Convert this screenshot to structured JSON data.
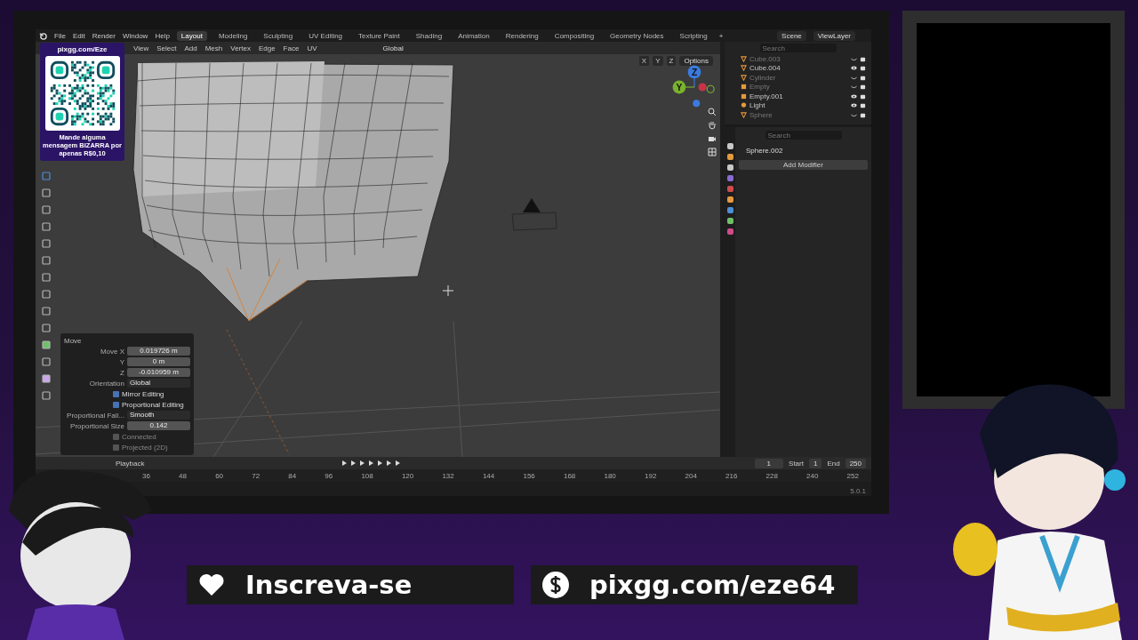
{
  "blender": {
    "menu": [
      "File",
      "Edit",
      "Render",
      "Window",
      "Help"
    ],
    "workspaces": [
      {
        "label": "Layout",
        "selected": true
      },
      {
        "label": "Modeling",
        "selected": false
      },
      {
        "label": "Sculpting",
        "selected": false
      },
      {
        "label": "UV Editing",
        "selected": false
      },
      {
        "label": "Texture Paint",
        "selected": false
      },
      {
        "label": "Shading",
        "selected": false
      },
      {
        "label": "Animation",
        "selected": false
      },
      {
        "label": "Rendering",
        "selected": false
      },
      {
        "label": "Compositing",
        "selected": false
      },
      {
        "label": "Geometry Nodes",
        "selected": false
      },
      {
        "label": "Scripting",
        "selected": false
      }
    ],
    "add_workspace": "+",
    "scene": "Scene",
    "view_layer": "ViewLayer",
    "viewport": {
      "menus": [
        "View",
        "Select",
        "Add",
        "Mesh",
        "Vertex",
        "Edge",
        "Face",
        "UV"
      ],
      "orientation": "Global",
      "axes": [
        "X",
        "Y",
        "Z"
      ],
      "options": "Options",
      "gizmo": [
        {
          "label": "Z",
          "color": "#3b7be0"
        },
        {
          "label": "Y",
          "color": "#7ab32b"
        }
      ]
    },
    "operator": {
      "title": "Move",
      "fields": [
        {
          "label": "Move X",
          "value": "0.019726 m"
        },
        {
          "label": "Y",
          "value": "0 m"
        },
        {
          "label": "Z",
          "value": "-0.010959 m"
        }
      ],
      "orientation_label": "Orientation",
      "orientation": "Global",
      "options": [
        {
          "label": "Mirror Editing",
          "checked": true
        },
        {
          "label": "Proportional Editing",
          "checked": true
        }
      ],
      "falloff_label": "Proportional Fall...",
      "falloff": "Smooth",
      "size_label": "Proportional Size",
      "size": "0.142",
      "extra": [
        {
          "label": "Connected",
          "checked": false
        },
        {
          "label": "Projected (2D)",
          "checked": false
        }
      ]
    },
    "outliner": {
      "search_placeholder": "Search",
      "items": [
        {
          "name": "Cube.003",
          "kind": "mesh",
          "visible": false
        },
        {
          "name": "Cube.004",
          "kind": "mesh",
          "visible": true
        },
        {
          "name": "Cylinder",
          "kind": "mesh",
          "visible": false
        },
        {
          "name": "Empty",
          "kind": "empty",
          "visible": false
        },
        {
          "name": "Empty.001",
          "kind": "empty",
          "visible": true
        },
        {
          "name": "Light",
          "kind": "light",
          "visible": true
        },
        {
          "name": "Sphere",
          "kind": "mesh",
          "visible": false
        }
      ]
    },
    "properties": {
      "search_placeholder": "Search",
      "object": "Sphere.002",
      "add_modifier": "Add Modifier"
    },
    "timeline": {
      "playback": "Playback",
      "frame": "1",
      "start_label": "Start",
      "start": "1",
      "end_label": "End",
      "end": "250",
      "ticks": [
        "36",
        "48",
        "60",
        "72",
        "84",
        "96",
        "108",
        "120",
        "132",
        "144",
        "156",
        "168",
        "180",
        "192",
        "204",
        "216",
        "228",
        "240",
        "252"
      ]
    },
    "version": "5.0.1"
  },
  "qr_overlay": {
    "title": "pixgg.com/Eze",
    "message": "Mande alguma mensagem BIZARRA por apenas R$0,10"
  },
  "banners": [
    {
      "kind": "heart",
      "label": "Inscreva-se"
    },
    {
      "kind": "dollar",
      "label": "pixgg.com/eze64"
    }
  ]
}
